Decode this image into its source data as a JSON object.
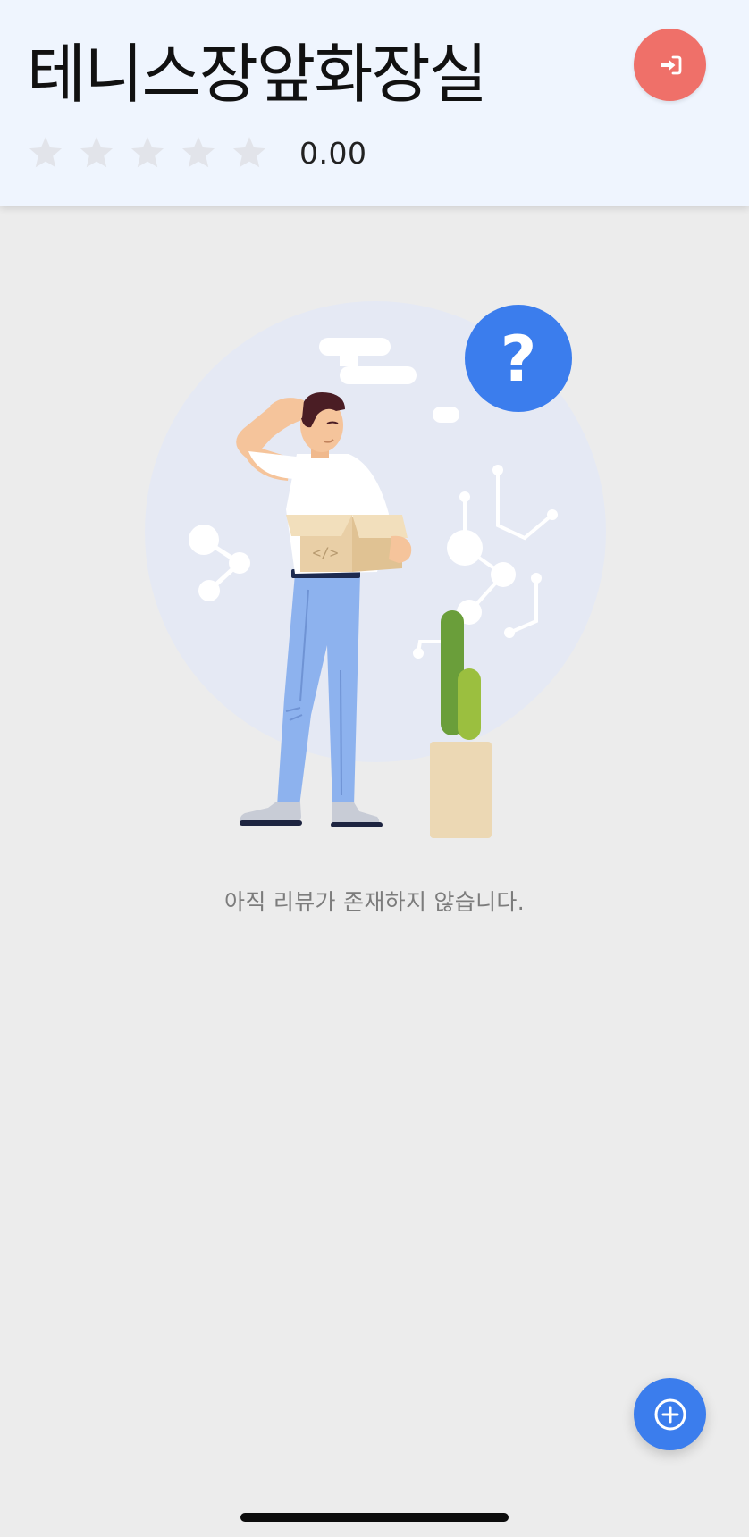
{
  "header": {
    "title": "테니스장앞화장실",
    "login_icon": "sign-in-icon",
    "rating": {
      "stars_filled": 0,
      "stars_total": 5,
      "value": "0.00"
    }
  },
  "empty_state": {
    "message": "아직 리뷰가 존재하지 않습니다.",
    "illustration_badge": "?"
  },
  "fab": {
    "icon": "plus-circle-icon"
  },
  "colors": {
    "header_bg": "#eff5fe",
    "page_bg": "#ececec",
    "login_button": "#ef7069",
    "add_button": "#3b7ded",
    "star_empty": "#e2e4ea"
  }
}
